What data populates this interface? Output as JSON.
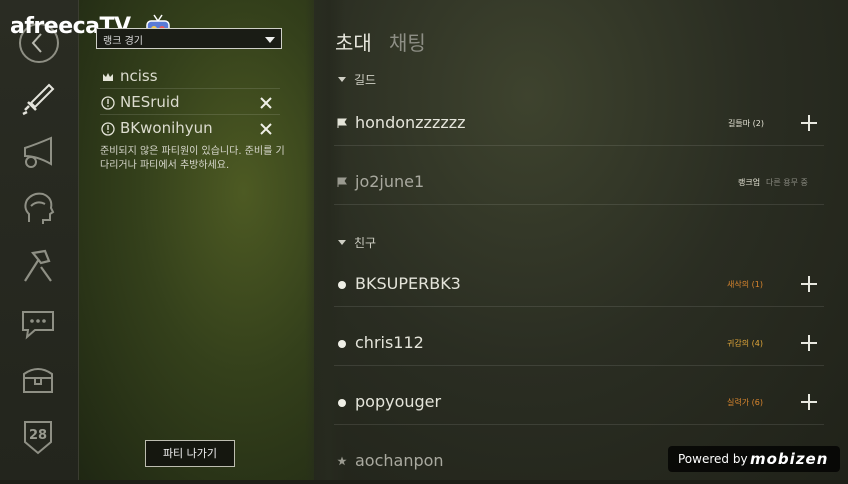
{
  "branding": {
    "logo_text": "afreecaTV"
  },
  "left_rail": {
    "icons": [
      "back-icon",
      "sword-icon",
      "horn-icon",
      "head-profile-icon",
      "hammer-tools-icon",
      "chat-bubble-icon",
      "chest-icon",
      "level-badge-icon"
    ],
    "level_badge": "28"
  },
  "party": {
    "mode_selected": "랭크 경기",
    "members": [
      {
        "name": "nciss",
        "role_icon": "crown-icon",
        "removable": false
      },
      {
        "name": "NESruid",
        "role_icon": "alert-icon",
        "removable": true
      },
      {
        "name": "BKwonihyun",
        "role_icon": "alert-icon",
        "removable": true
      }
    ],
    "notice": "준비되지 않은 파티원이 있습니다. 준비를 기다리거나 파티에서 추방하세요.",
    "leave_label": "파티 나가기"
  },
  "tabs": {
    "invite": "초대",
    "chat": "채팅"
  },
  "guild": {
    "header": "길드",
    "members": [
      {
        "name": "hondonzzzzzz",
        "status": "길들마 (2)",
        "status_color": "#e8e6d8",
        "can_invite": true
      },
      {
        "name": "jo2june1",
        "status": "랭크업",
        "status_extra": "다른 용무 중",
        "status_color": "#e8e6d8",
        "can_invite": false
      }
    ]
  },
  "friends": {
    "header": "친구",
    "members": [
      {
        "name": "BKSUPERBK3",
        "status": "새삭의 (1)",
        "status_color": "#d9862e",
        "can_invite": true
      },
      {
        "name": "chris112",
        "status": "귀감의 (4)",
        "status_color": "#e0a63a",
        "can_invite": true
      },
      {
        "name": "popyouger",
        "status": "실력가 (6)",
        "status_color": "#d9862e",
        "can_invite": true
      },
      {
        "name": "aochanpon",
        "status": "",
        "status_color": "#aaaaaa",
        "can_invite": false
      }
    ]
  },
  "watermark": {
    "prefix": "Powered by",
    "brand": "mobizen"
  }
}
